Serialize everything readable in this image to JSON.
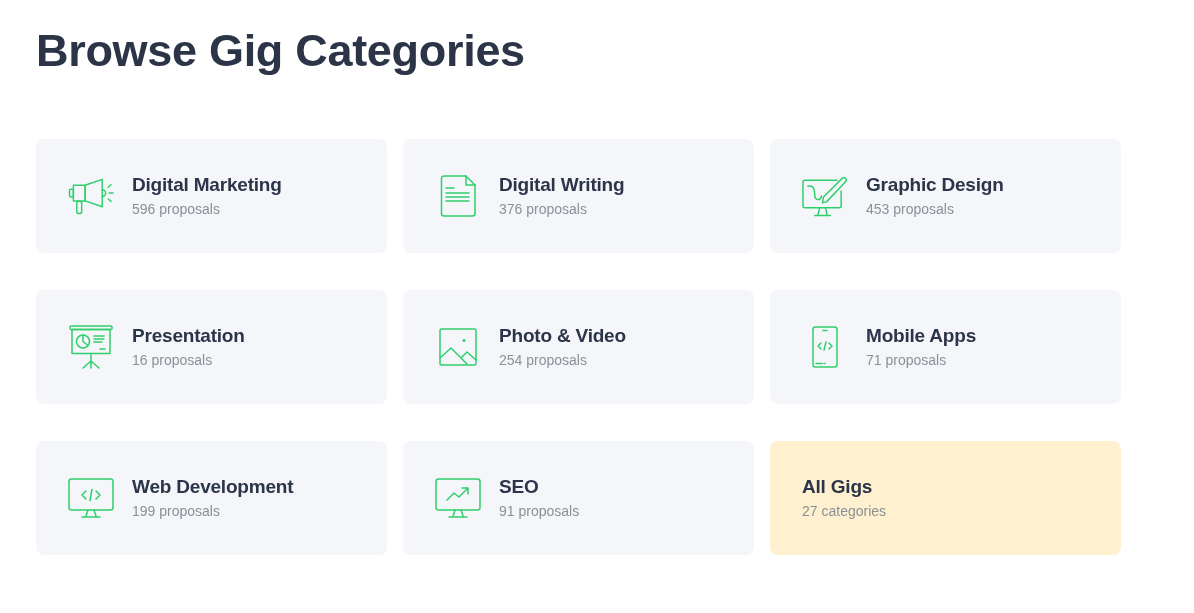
{
  "title": "Browse Gig Categories",
  "categories": [
    {
      "kind": "category",
      "name": "Digital Marketing",
      "count": "596 proposals"
    },
    {
      "kind": "category",
      "name": "Digital Writing",
      "count": "376 proposals"
    },
    {
      "kind": "category",
      "name": "Graphic Design",
      "count": "453 proposals"
    },
    {
      "kind": "category",
      "name": "Presentation",
      "count": "16 proposals"
    },
    {
      "kind": "category",
      "name": "Photo & Video",
      "count": "254 proposals"
    },
    {
      "kind": "category",
      "name": "Mobile Apps",
      "count": "71 proposals"
    },
    {
      "kind": "category",
      "name": "Web Development",
      "count": "199 proposals"
    },
    {
      "kind": "category",
      "name": "SEO",
      "count": "91 proposals"
    },
    {
      "kind": "summary",
      "name": "All Gigs",
      "count": "27 categories"
    }
  ]
}
